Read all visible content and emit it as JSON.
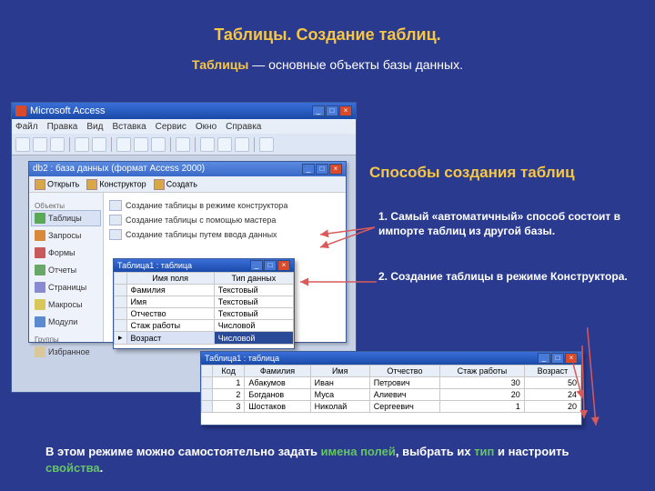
{
  "slide": {
    "title": "Таблицы. Создание таблиц.",
    "subtitle_prefix": "Таблицы",
    "subtitle_rest": " — основные объекты базы данных.",
    "ways_title": "Способы создания таблиц",
    "way1": "1. Самый «автоматичный» способ состоит в импорте таблиц из другой базы.",
    "way2": "2.  Создание таблицы в режиме Конструктора.",
    "bottom_p1": "В этом режиме можно самостоятельно задать ",
    "bottom_g1": "имена полей",
    "bottom_p2": ", выбрать их ",
    "bottom_g2": "тип",
    "bottom_p3": " и настроить ",
    "bottom_g3": "свойства",
    "bottom_p4": "."
  },
  "access": {
    "title": "Microsoft Access",
    "menu": [
      "Файл",
      "Правка",
      "Вид",
      "Вставка",
      "Сервис",
      "Окно",
      "Справка"
    ]
  },
  "db": {
    "title": "db2 : база данных (формат Access 2000)",
    "toolbar": {
      "open": "Открыть",
      "design": "Конструктор",
      "new": "Создать"
    },
    "cats": {
      "objects": "Объекты",
      "tables": "Таблицы",
      "queries": "Запросы",
      "forms": "Формы",
      "reports": "Отчеты",
      "pages": "Страницы",
      "macros": "Макросы",
      "modules": "Модули",
      "groups": "Группы",
      "favorites": "Избранное"
    },
    "options": {
      "design": "Создание таблицы в режиме конструктора",
      "wizard": "Создание таблицы с помощью мастера",
      "entry": "Создание таблицы путем ввода данных"
    }
  },
  "design_table": {
    "title": "Таблица1 : таблица",
    "head_name": "Имя поля",
    "head_type": "Тип данных",
    "rows": [
      {
        "name": "Фамилия",
        "type": "Текстовый"
      },
      {
        "name": "Имя",
        "type": "Текстовый"
      },
      {
        "name": "Отчество",
        "type": "Текстовый"
      },
      {
        "name": "Стаж работы",
        "type": "Числовой"
      },
      {
        "name": "Возраст",
        "type": "Числовой"
      }
    ]
  },
  "data_table": {
    "title": "Таблица1 : таблица",
    "cols": [
      "Код",
      "Фамилия",
      "Имя",
      "Отчество",
      "Стаж работы",
      "Возраст"
    ],
    "rows": [
      {
        "c0": "1",
        "c1": "Абакумов",
        "c2": "Иван",
        "c3": "Петрович",
        "c4": "30",
        "c5": "50"
      },
      {
        "c0": "2",
        "c1": "Богданов",
        "c2": "Муса",
        "c3": "Алиевич",
        "c4": "20",
        "c5": "24"
      },
      {
        "c0": "3",
        "c1": "Шостаков",
        "c2": "Николай",
        "c3": "Сергеевич",
        "c4": "1",
        "c5": "20"
      }
    ]
  }
}
